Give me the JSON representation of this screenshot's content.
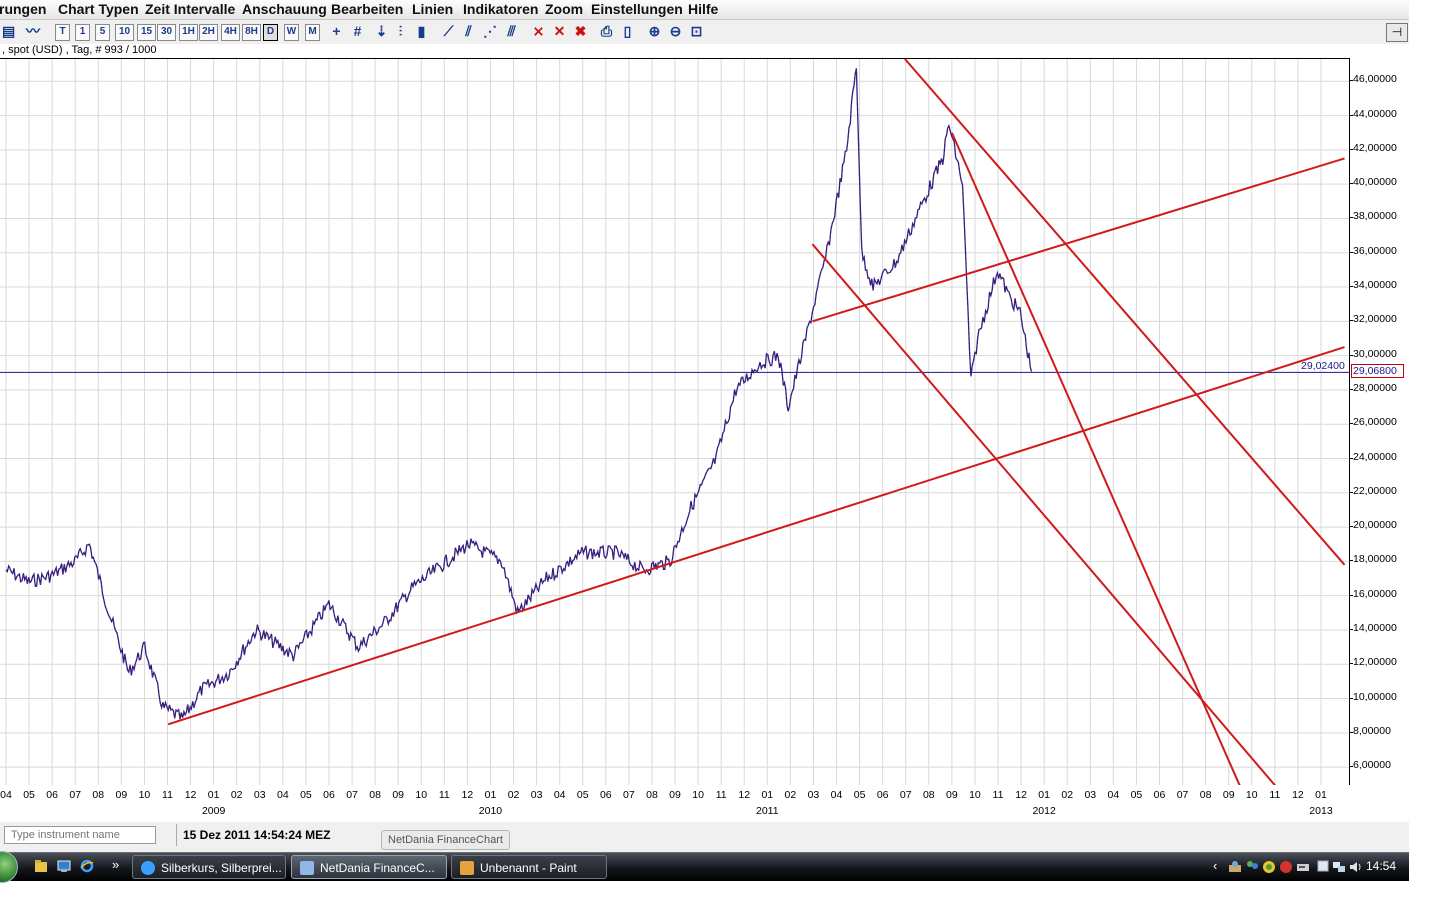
{
  "menubar": {
    "items": [
      "rungen",
      "Chart Typen",
      "Zeit Intervalle",
      "Anschauung",
      "Bearbeiten",
      "Linien",
      "Indikatoren",
      "Zoom",
      "Einstellungen",
      "Hilfe"
    ]
  },
  "toolbar": {
    "interval_buttons": [
      "T",
      "1",
      "5",
      "10",
      "15",
      "30",
      "1H",
      "2H",
      "4H",
      "8H",
      "D",
      "W",
      "M"
    ],
    "selected_interval": "D",
    "icons": [
      "table-icon",
      "line-chart-icon",
      "crosshair-icon",
      "grid-icon",
      "arrow-down-icon",
      "ohlc-icon",
      "candle-icon",
      "trendline-icon",
      "parallel-lines-icon",
      "fan-lines-icon",
      "channel-icon",
      "delete-line-icon",
      "delete-icon",
      "delete-all-icon",
      "print-icon",
      "print-preview-icon",
      "zoom-in-icon",
      "zoom-out-icon",
      "zoom-reset-icon",
      "dock-icon"
    ]
  },
  "info": {
    "text": ", spot (USD) , Tag, # 993 / 1000"
  },
  "yaxis": {
    "labels": [
      "46,00000",
      "44,00000",
      "42,00000",
      "40,00000",
      "38,00000",
      "36,00000",
      "34,00000",
      "32,00000",
      "30,00000",
      "28,00000",
      "26,00000",
      "24,00000",
      "22,00000",
      "20,00000",
      "18,00000",
      "16,00000",
      "14,00000",
      "12,00000",
      "10,00000",
      "8,00000",
      "6,00000"
    ]
  },
  "price": {
    "current": "29,06800",
    "crosshair": "29,02400"
  },
  "xaxis": {
    "months": [
      "04",
      "05",
      "06",
      "07",
      "08",
      "09",
      "10",
      "11",
      "12",
      "01",
      "02",
      "03",
      "04",
      "05",
      "06",
      "07",
      "08",
      "09",
      "10",
      "11",
      "12",
      "01",
      "02",
      "03",
      "04",
      "05",
      "06",
      "07",
      "08",
      "09",
      "10",
      "11",
      "12",
      "01",
      "02",
      "03",
      "04",
      "05",
      "06",
      "07",
      "08",
      "09",
      "10",
      "11",
      "12",
      "01",
      "02",
      "03",
      "04",
      "05",
      "06",
      "07",
      "08",
      "09",
      "10",
      "11",
      "12",
      "01"
    ],
    "years": [
      "2009",
      "2010",
      "2011",
      "2012",
      "2013"
    ]
  },
  "bottombar": {
    "instrument_placeholder": "Type instrument name",
    "timestamp": "15 Dez 2011 14:54:24 MEZ",
    "tooltip": "NetDania FinanceChart"
  },
  "taskbar": {
    "tasks": [
      "Silberkurs, Silberprei...",
      "NetDania FinanceC...",
      "Unbenannt - Paint"
    ],
    "active_task": "NetDania FinanceC...",
    "clock": "14:54"
  },
  "chart_data": {
    "type": "line",
    "title": "",
    "xlabel": "",
    "ylabel": "",
    "ylim": [
      4.9,
      47.3
    ],
    "grid": true,
    "x_start": "2008-04",
    "x_end": "2013-01",
    "series": [
      {
        "values": [
          [
            "2008-04-01",
            17.5
          ],
          [
            "2008-05-01",
            16.8
          ],
          [
            "2008-06-01",
            17.2
          ],
          [
            "2008-07-01",
            18.0
          ],
          [
            "2008-07-20",
            19.0
          ],
          [
            "2008-08-15",
            15.0
          ],
          [
            "2008-09-10",
            11.5
          ],
          [
            "2008-10-01",
            13.0
          ],
          [
            "2008-10-25",
            9.5
          ],
          [
            "2008-11-20",
            8.8
          ],
          [
            "2008-12-15",
            10.5
          ],
          [
            "2009-01-20",
            11.5
          ],
          [
            "2009-02-25",
            14.0
          ],
          [
            "2009-04-15",
            12.5
          ],
          [
            "2009-06-01",
            15.5
          ],
          [
            "2009-07-10",
            13.0
          ],
          [
            "2009-08-15",
            14.5
          ],
          [
            "2009-09-20",
            16.5
          ],
          [
            "2009-10-20",
            17.5
          ],
          [
            "2009-12-02",
            19.0
          ],
          [
            "2010-01-15",
            18.0
          ],
          [
            "2010-02-05",
            15.0
          ],
          [
            "2010-03-15",
            17.0
          ],
          [
            "2010-05-01",
            18.5
          ],
          [
            "2010-06-15",
            18.5
          ],
          [
            "2010-07-20",
            17.5
          ],
          [
            "2010-08-25",
            18.0
          ],
          [
            "2010-09-20",
            21.0
          ],
          [
            "2010-10-25",
            24.0
          ],
          [
            "2010-11-20",
            28.0
          ],
          [
            "2010-12-20",
            29.5
          ],
          [
            "2011-01-15",
            30.0
          ],
          [
            "2011-01-28",
            27.0
          ],
          [
            "2011-02-20",
            31.0
          ],
          [
            "2011-03-20",
            36.0
          ],
          [
            "2011-04-15",
            42.0
          ],
          [
            "2011-04-28",
            47.0
          ],
          [
            "2011-05-05",
            36.0
          ],
          [
            "2011-05-20",
            34.0
          ],
          [
            "2011-06-20",
            35.5
          ],
          [
            "2011-07-20",
            38.5
          ],
          [
            "2011-08-20",
            41.5
          ],
          [
            "2011-08-28",
            43.5
          ],
          [
            "2011-09-15",
            40.0
          ],
          [
            "2011-09-26",
            28.5
          ],
          [
            "2011-10-05",
            31.0
          ],
          [
            "2011-10-31",
            35.0
          ],
          [
            "2011-11-15",
            33.5
          ],
          [
            "2011-11-30",
            32.5
          ],
          [
            "2011-12-15",
            29.07
          ]
        ]
      }
    ],
    "trendlines": [
      {
        "from": [
          "2008-11-01",
          8.5
        ],
        "to": [
          "2013-01-31",
          30.5
        ]
      },
      {
        "from": [
          "2011-03-01",
          32.0
        ],
        "to": [
          "2013-01-31",
          41.5
        ]
      },
      {
        "from": [
          "2011-03-01",
          36.5
        ],
        "to": [
          "2012-11-01",
          4.9
        ]
      },
      {
        "from": [
          "2011-09-01",
          43.0
        ],
        "to": [
          "2012-09-15",
          4.9
        ]
      },
      {
        "from": [
          "2011-07-01",
          47.3
        ],
        "to": [
          "2013-01-31",
          17.8
        ]
      }
    ],
    "horizontal_line": 29.024,
    "last_price": 29.068
  }
}
